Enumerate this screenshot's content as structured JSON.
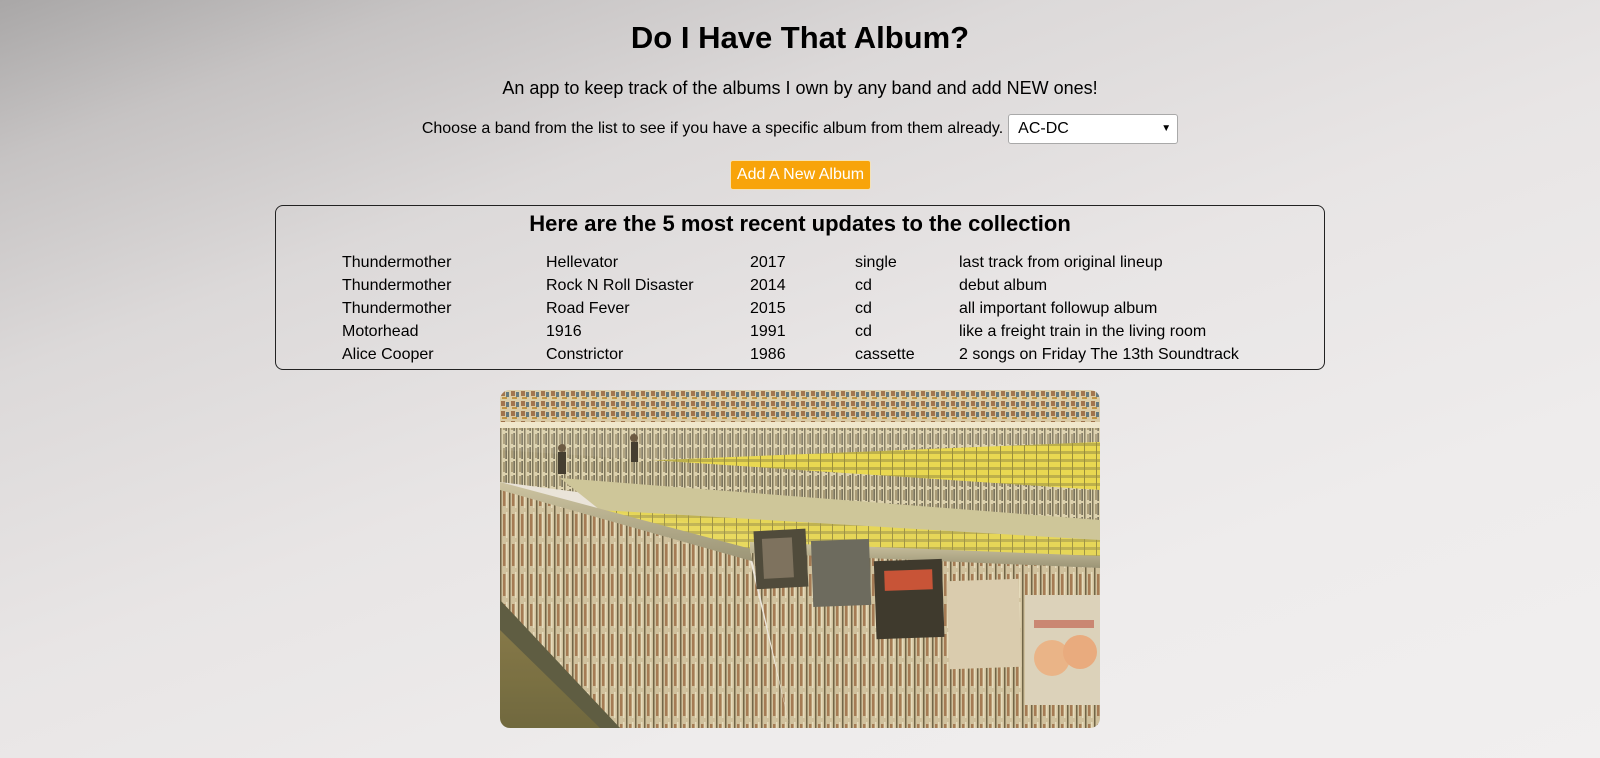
{
  "header": {
    "title": "Do I Have That Album?",
    "subtitle": "An app to keep track of the albums I own by any band and add NEW ones!"
  },
  "chooser": {
    "label": "Choose a band from the list to see if you have a specific album from them already.",
    "selected_band": "AC-DC"
  },
  "add_button": {
    "label": "Add A New Album",
    "color": "#f8a40a"
  },
  "recent": {
    "heading": "Here are the 5 most recent updates to the collection",
    "rows": [
      {
        "band": "Thundermother",
        "album": "Hellevator",
        "year": "2017",
        "format": "single",
        "note": "last track from original lineup"
      },
      {
        "band": "Thundermother",
        "album": "Rock N Roll Disaster",
        "year": "2014",
        "format": "cd",
        "note": "debut album"
      },
      {
        "band": "Thundermother",
        "album": "Road Fever",
        "year": "2015",
        "format": "cd",
        "note": "all important followup album"
      },
      {
        "band": "Motorhead",
        "album": "1916",
        "year": "1991",
        "format": "cd",
        "note": "like a freight train in the living room"
      },
      {
        "band": "Alice Cooper",
        "album": "Constrictor",
        "year": "1986",
        "format": "cassette",
        "note": "2 songs on Friday The 13th Soundtrack"
      }
    ]
  },
  "photo": {
    "subject": "record-store-photo"
  }
}
